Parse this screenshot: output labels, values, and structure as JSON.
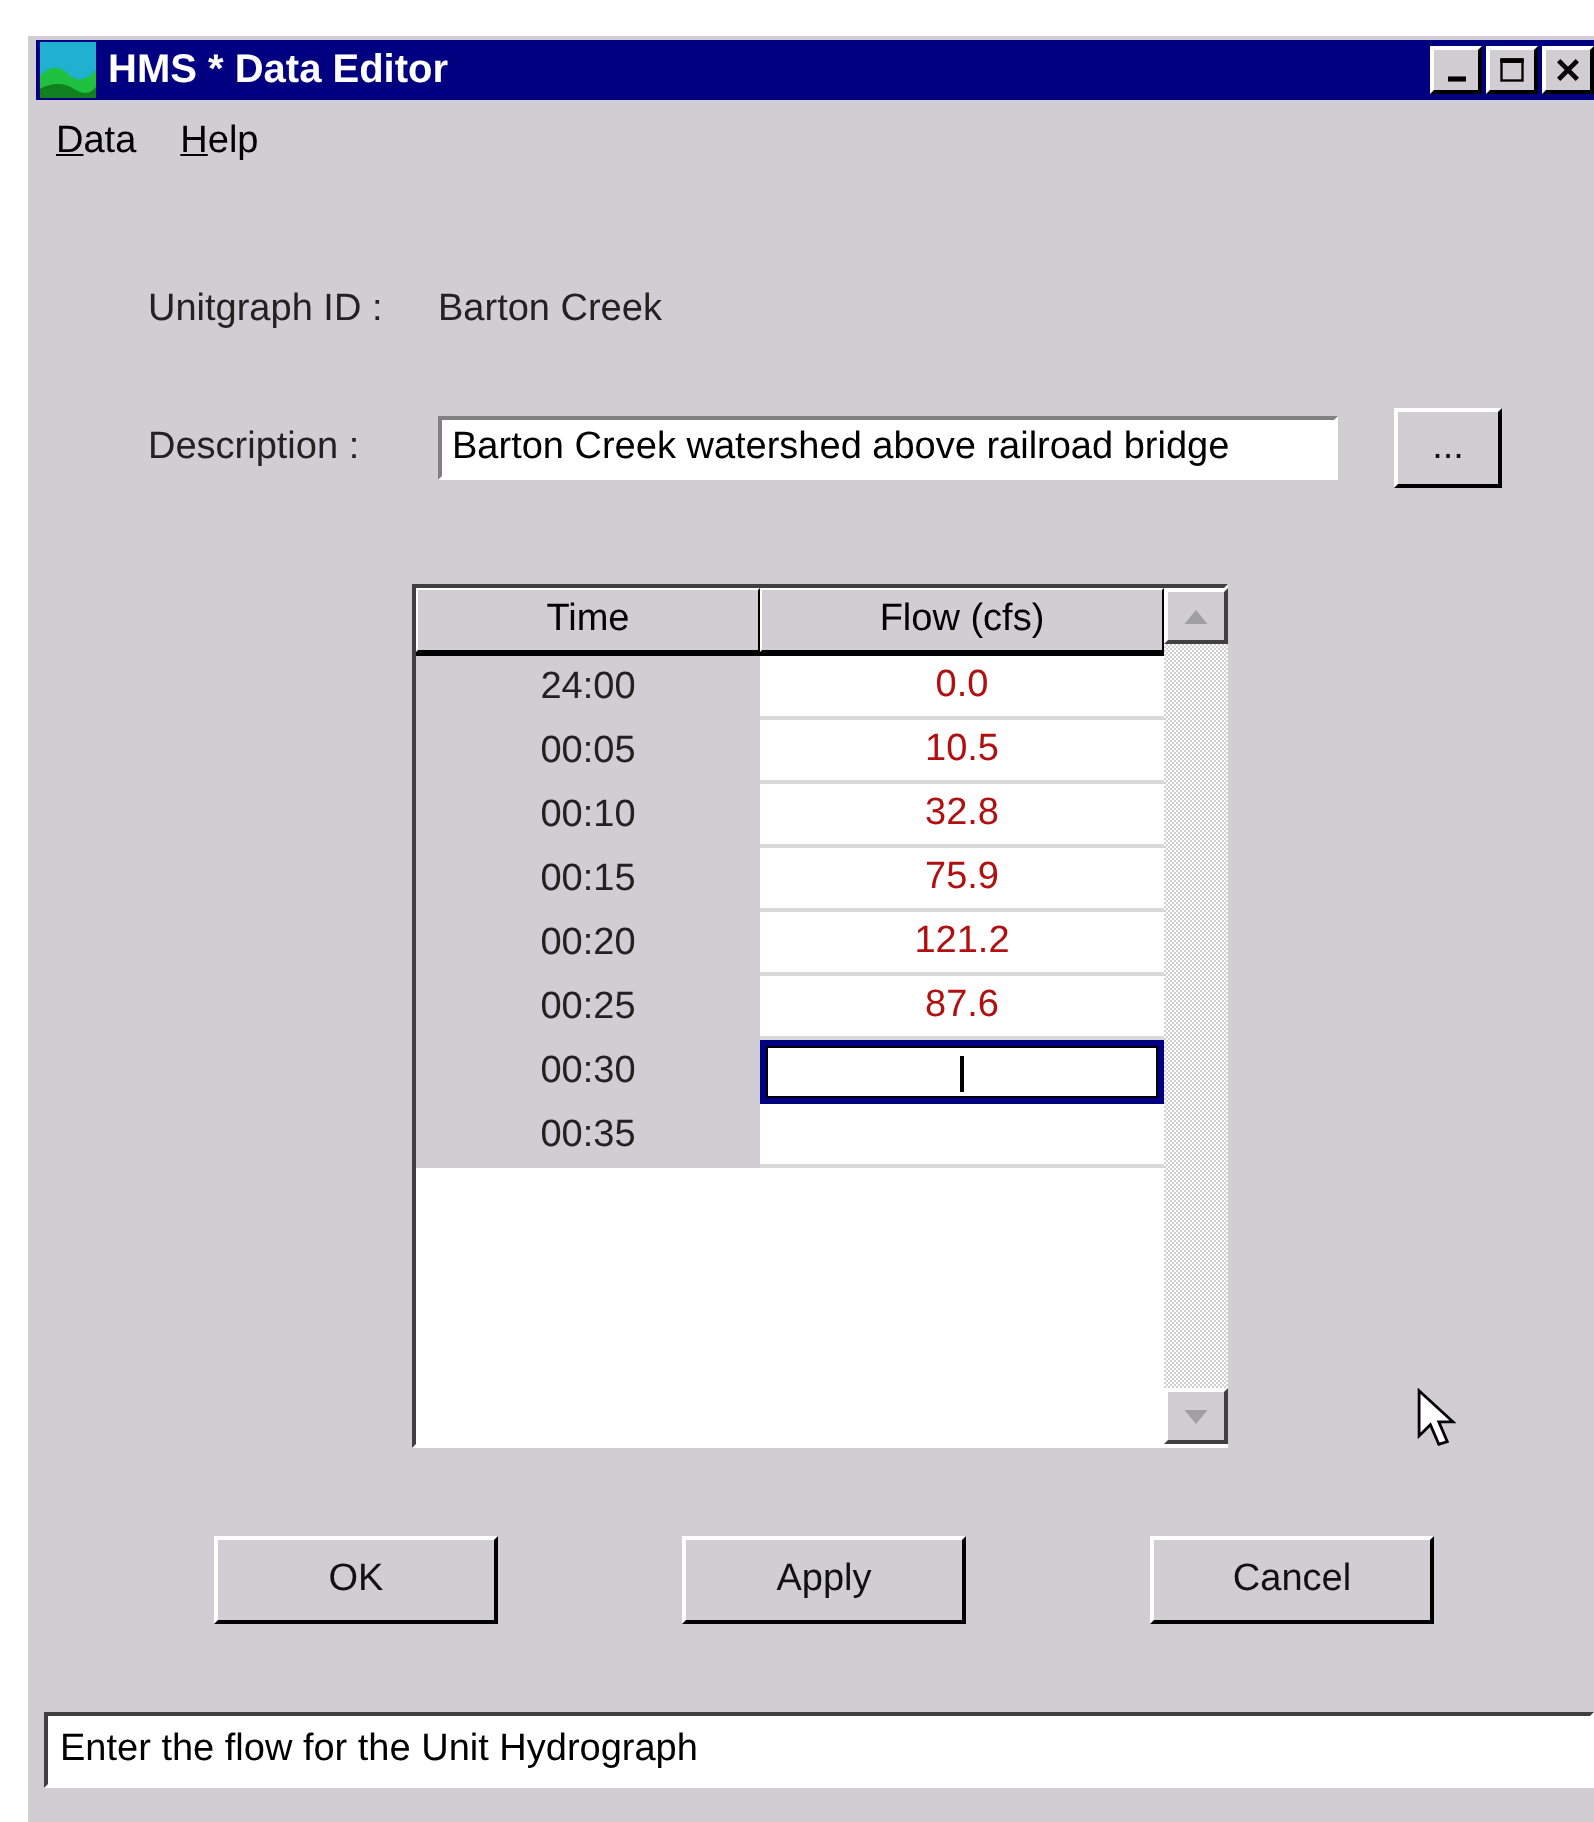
{
  "window": {
    "title": "HMS * Data Editor"
  },
  "menu": [
    {
      "label": "Data"
    },
    {
      "label": "Help"
    }
  ],
  "unitgraph_id": {
    "label": "Unitgraph ID :",
    "value": "Barton Creek"
  },
  "description": {
    "label": "Description :",
    "value": "Barton Creek watershed above railroad bridge",
    "browse_button": "..."
  },
  "table": {
    "columns": [
      "Time",
      "Flow (cfs)"
    ],
    "rows": [
      {
        "time": "24:00",
        "flow": "0.0",
        "selected": false
      },
      {
        "time": "00:05",
        "flow": "10.5",
        "selected": false
      },
      {
        "time": "00:10",
        "flow": "32.8",
        "selected": false
      },
      {
        "time": "00:15",
        "flow": "75.9",
        "selected": false
      },
      {
        "time": "00:20",
        "flow": "121.2",
        "selected": false
      },
      {
        "time": "00:25",
        "flow": "87.6",
        "selected": false
      },
      {
        "time": "00:30",
        "flow": "",
        "selected": true
      },
      {
        "time": "00:35",
        "flow": "",
        "selected": false
      }
    ]
  },
  "buttons": [
    "OK",
    "Apply",
    "Cancel"
  ],
  "status_bar": "Enter the flow for the Unit Hydrograph"
}
